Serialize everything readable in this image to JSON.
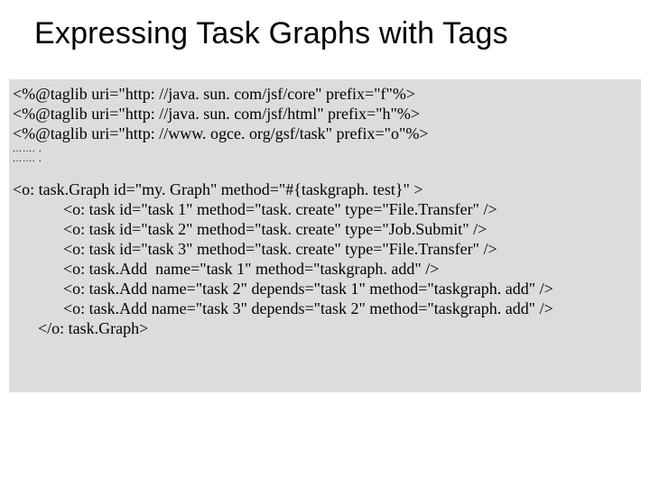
{
  "title": "Expressing Task Graphs with Tags",
  "code": {
    "taglib1": "<%@taglib uri=\"http: //java. sun. com/jsf/core\" prefix=\"f\"%>",
    "taglib2": "<%@taglib uri=\"http: //java. sun. com/jsf/html\" prefix=\"h\"%>",
    "taglib3": "<%@taglib uri=\"http: //www. ogce. org/gsf/task\" prefix=\"o\"%>",
    "dots1": "……. .",
    "dots2": "……. .",
    "graphOpen": "<o: task.Graph id=\"my. Graph\" method=\"#{taskgraph. test}\" >",
    "task1": "<o: task id=\"task 1\" method=\"task. create\" type=\"File.Transfer\" />",
    "task2": "<o: task id=\"task 2\" method=\"task. create\" type=\"Job.Submit\" />",
    "task3": "<o: task id=\"task 3\" method=\"task. create\" type=\"File.Transfer\" />",
    "add1": "<o: task.Add  name=\"task 1\" method=\"taskgraph. add\" />",
    "add2": "<o: task.Add name=\"task 2\" depends=\"task 1\" method=\"taskgraph. add\" />",
    "add3": "<o: task.Add name=\"task 3\" depends=\"task 2\" method=\"taskgraph. add\" />",
    "graphClose": "</o: task.Graph>"
  }
}
